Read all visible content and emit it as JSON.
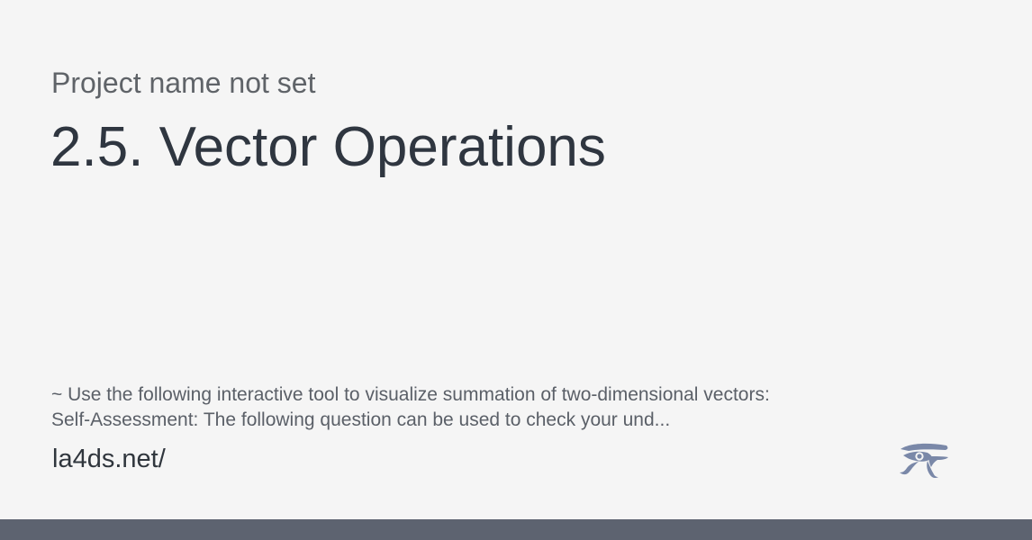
{
  "header": {
    "project_name": "Project name not set",
    "title": "2.5. Vector Operations"
  },
  "description": {
    "line1": "~ Use the following interactive tool to visualize summation of two-dimensional vectors:",
    "line2": "Self-Assessment: The following question can be used to check your und..."
  },
  "footer": {
    "url": "la4ds.net/"
  },
  "logo": {
    "icon": "eye-of-horus-icon",
    "color": "#7a88a8"
  },
  "colors": {
    "background": "#f5f5f5",
    "footer_bar": "#5d6370",
    "title": "#2f3640",
    "subtitle": "#5f6368"
  }
}
